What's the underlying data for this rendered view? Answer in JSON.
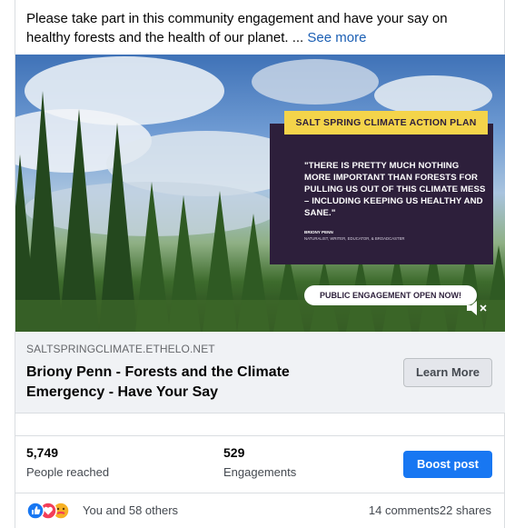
{
  "post": {
    "text": "Please take part in this community engagement and have your say on healthy forests and the health of our planet. ... ",
    "see_more": "See more"
  },
  "media": {
    "plan_label": "SALT SPRING CLIMATE ACTION PLAN",
    "quote": "\"THERE IS PRETTY MUCH NOTHING MORE IMPORTANT THAN FORESTS FOR PULLING US OUT OF THIS CLIMATE MESS – INCLUDING KEEPING US HEALTHY AND SANE.\"",
    "author": "BRIONY PENN",
    "author_role": "NATURALIST, WRITER, EDUCATOR, & BROADCASTER",
    "engage_label": "PUBLIC ENGAGEMENT OPEN NOW!"
  },
  "link": {
    "domain": "SALTSPRINGCLIMATE.ETHELO.NET",
    "title": "Briony Penn - Forests and the Climate Emergency - Have Your Say",
    "learn_more": "Learn More"
  },
  "stats": {
    "reached_value": "5,749",
    "reached_label": "People reached",
    "engagements_value": "529",
    "engagements_label": "Engagements",
    "boost_label": "Boost post"
  },
  "footer": {
    "reactions_text": "You and 58 others",
    "comments_shares": "14 comments22 shares",
    "reaction_icons": [
      "like-icon",
      "love-icon",
      "care-icon"
    ]
  },
  "colors": {
    "primary_blue": "#1877f2",
    "like_blue": "#1877f2",
    "love_red": "#f33e58",
    "care_yellow": "#f7b125",
    "plan_label_yellow": "#f4d44a",
    "quote_box_purple": "#2d1f3b"
  }
}
